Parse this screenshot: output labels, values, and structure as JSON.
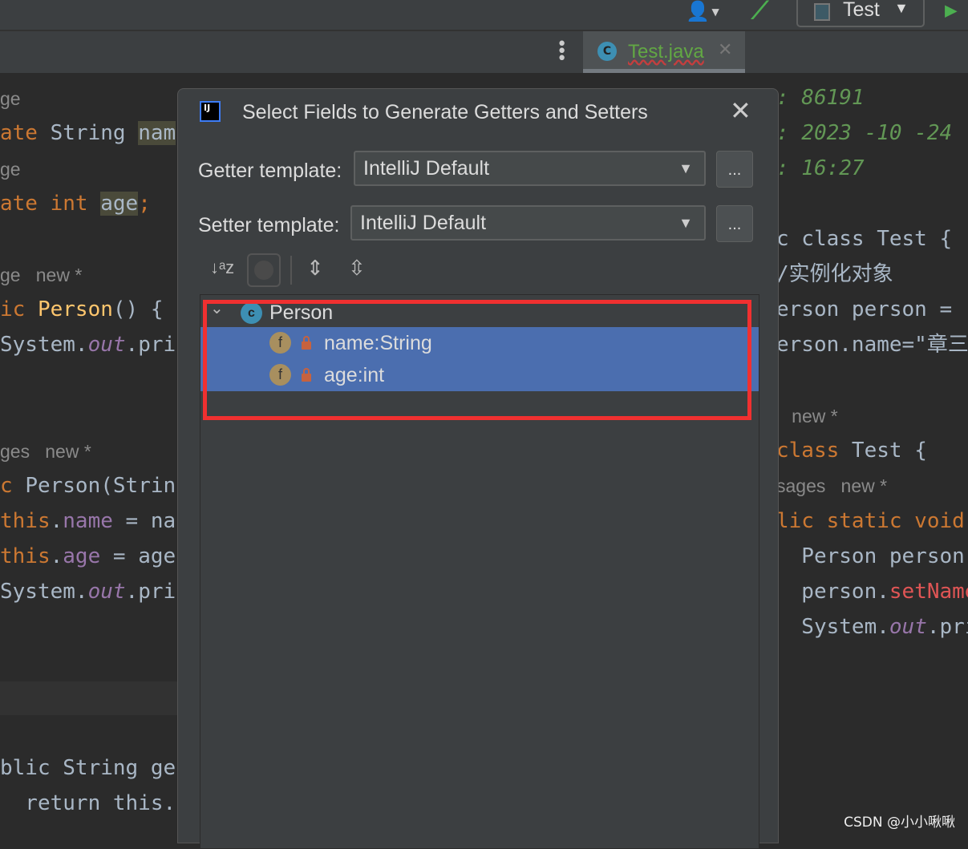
{
  "toolbar": {
    "run_config": "Test",
    "user_icon": "user-icon",
    "build_icon": "hammer-icon",
    "run_icon": "play-icon"
  },
  "tabs": [
    {
      "label": "Test.java",
      "icon": "C"
    }
  ],
  "left_code": [
    [
      [
        "gr",
        "ge"
      ]
    ],
    [
      [
        "kw",
        "ate "
      ],
      [
        "",
        "String "
      ],
      [
        "hl",
        "nam"
      ]
    ],
    [
      [
        "gr",
        "ge"
      ]
    ],
    [
      [
        "kw",
        "ate int "
      ],
      [
        "hl",
        "age"
      ],
      [
        "kw",
        ";"
      ]
    ],
    [
      [
        "gr",
        "ge   new *"
      ]
    ],
    [
      [
        "kw",
        "ic "
      ],
      [
        "fn",
        "Person"
      ],
      [
        "",
        "() {"
      ]
    ],
    [
      [
        "",
        "System."
      ],
      [
        "it",
        "out"
      ],
      [
        "",
        ".pri"
      ]
    ],
    [
      [
        "gr",
        "ges   new *"
      ]
    ],
    [
      [
        "kw",
        "c "
      ],
      [
        "",
        "Person(Strin"
      ]
    ],
    [
      [
        "kw",
        "this"
      ],
      [
        "",
        "."
      ],
      [
        "fld",
        "name"
      ],
      [
        "",
        " = na"
      ]
    ],
    [
      [
        "kw",
        "this"
      ],
      [
        "",
        "."
      ],
      [
        "fld",
        "age"
      ],
      [
        "",
        " = age"
      ]
    ],
    [
      [
        "",
        "System."
      ],
      [
        "it",
        "out"
      ],
      [
        "",
        ".pri"
      ]
    ],
    [
      [
        "",
        "blic String ge"
      ]
    ],
    [
      [
        "",
        "  return this."
      ]
    ]
  ],
  "right_code": [
    [
      [
        "cm",
        ": 86191"
      ]
    ],
    [
      [
        "cm",
        ": 2023 -10 -24"
      ]
    ],
    [
      [
        "cm",
        ": 16:27"
      ]
    ],
    [
      [
        "",
        "c class Test {"
      ]
    ],
    [
      [
        "",
        "/实例化对象"
      ]
    ],
    [
      [
        "",
        "erson person ="
      ]
    ],
    [
      [
        "",
        "erson.name=\"章三"
      ]
    ],
    [
      [
        "gr",
        "   new *"
      ]
    ],
    [
      [
        "kw",
        "class "
      ],
      [
        "",
        "Test {"
      ]
    ],
    [
      [
        "gr",
        "sages   new *"
      ]
    ],
    [
      [
        "kw",
        "lic static void"
      ]
    ],
    [
      [
        "",
        "  Person person"
      ]
    ],
    [
      [
        "",
        "  person."
      ],
      [
        "red",
        "setName"
      ]
    ],
    [
      [
        "",
        "  System."
      ],
      [
        "it",
        "out"
      ],
      [
        "",
        ".pri"
      ]
    ]
  ],
  "dialog": {
    "title": "Select Fields to Generate Getters and Setters",
    "getter_label": "Getter template:",
    "getter_value": "IntelliJ Default",
    "setter_label": "Setter template:",
    "setter_value": "IntelliJ Default",
    "more": "...",
    "tree": {
      "class_name": "Person",
      "fields": [
        "name:String",
        "age:int"
      ]
    }
  },
  "watermark": "CSDN @小小啾啾",
  "colors": {
    "selection": "#4b6eaf",
    "highlight_box": "#f03030"
  }
}
